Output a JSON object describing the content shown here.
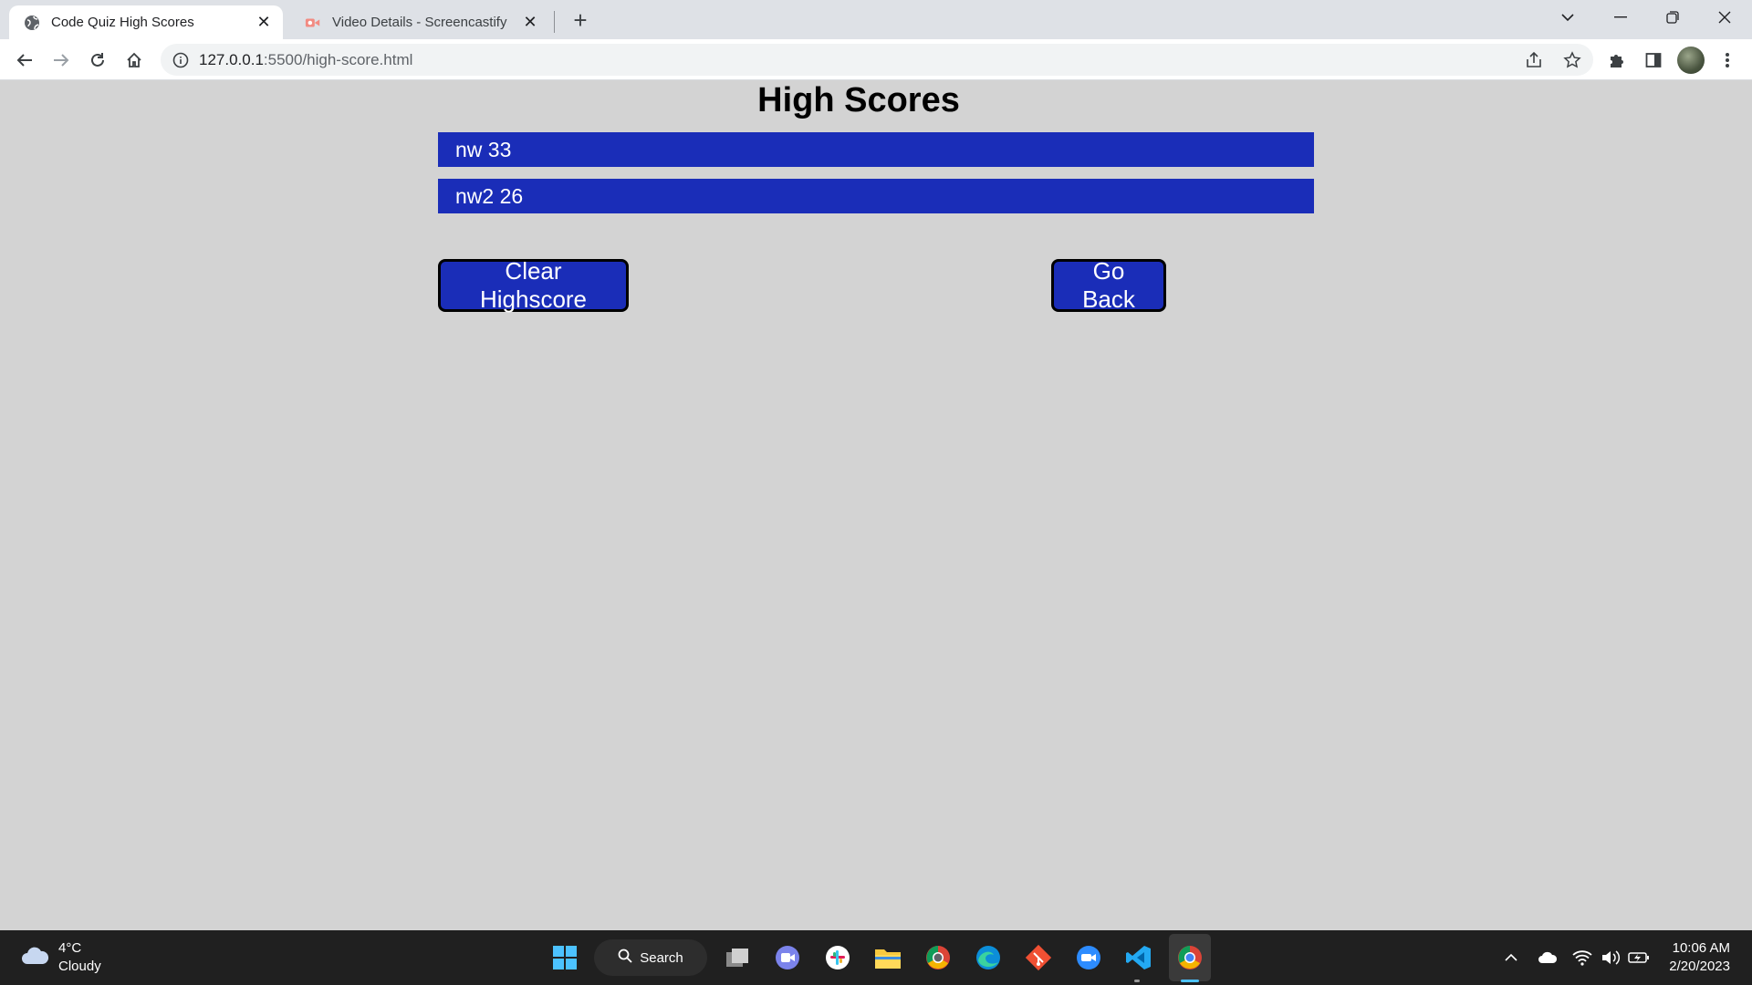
{
  "browser": {
    "tabs": [
      {
        "title": "Code Quiz High Scores",
        "active": true,
        "icon": "globe-icon"
      },
      {
        "title": "Video Details - Screencastify",
        "active": false,
        "icon": "screencastify-icon"
      }
    ],
    "address": {
      "host": "127.0.0.1",
      "rest": ":5500/high-score.html"
    }
  },
  "page": {
    "title": "High Scores",
    "scores": [
      "nw 33",
      "nw2 26"
    ],
    "clear_label": "Clear Highscore",
    "back_label": "Go Back",
    "accent_color": "#1a2db8",
    "background_color": "#d3d3d3"
  },
  "taskbar": {
    "weather": {
      "temp": "4°C",
      "condition": "Cloudy"
    },
    "search_label": "Search",
    "apps": [
      "start-icon",
      "task-view-icon",
      "teams-icon",
      "slack-icon",
      "file-explorer-icon",
      "chrome-dev-icon",
      "edge-icon",
      "git-icon",
      "zoom-icon",
      "vscode-icon",
      "chrome-icon"
    ],
    "time": "10:06 AM",
    "date": "2/20/2023"
  }
}
